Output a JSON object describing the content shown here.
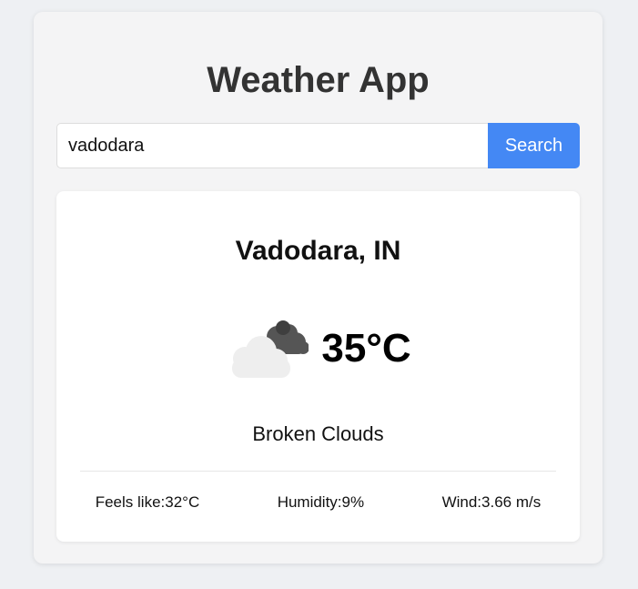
{
  "app": {
    "title": "Weather App"
  },
  "search": {
    "value": "vadodara",
    "button_label": "Search"
  },
  "weather": {
    "city": "Vadodara, IN",
    "icon": "broken-clouds-icon",
    "temperature": "35°C",
    "description": "Broken Clouds",
    "feels_like_label": "Feels like: ",
    "feels_like_value": "32°C",
    "humidity_label": "Humidity: ",
    "humidity_value": "9%",
    "wind_label": "Wind: ",
    "wind_value": "3.66 m/s"
  },
  "colors": {
    "accent": "#4488f4",
    "title": "#333333",
    "page_background": "#eef0f3",
    "panel_background": "#f4f4f5",
    "card_background": "#ffffff"
  }
}
